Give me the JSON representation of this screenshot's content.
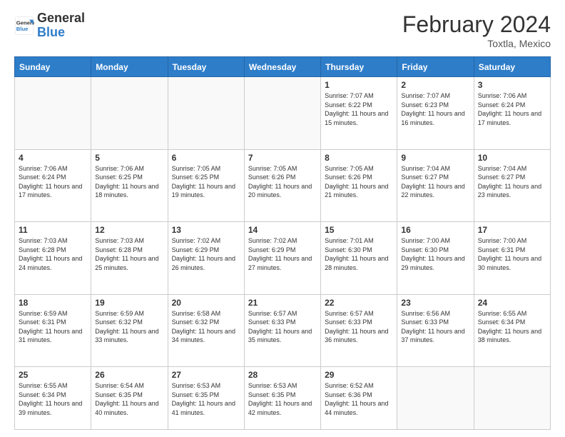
{
  "header": {
    "logo_line1": "General",
    "logo_line2": "Blue",
    "month": "February 2024",
    "location": "Toxtla, Mexico"
  },
  "weekdays": [
    "Sunday",
    "Monday",
    "Tuesday",
    "Wednesday",
    "Thursday",
    "Friday",
    "Saturday"
  ],
  "weeks": [
    [
      {
        "day": "",
        "info": ""
      },
      {
        "day": "",
        "info": ""
      },
      {
        "day": "",
        "info": ""
      },
      {
        "day": "",
        "info": ""
      },
      {
        "day": "1",
        "info": "Sunrise: 7:07 AM\nSunset: 6:22 PM\nDaylight: 11 hours and 15 minutes."
      },
      {
        "day": "2",
        "info": "Sunrise: 7:07 AM\nSunset: 6:23 PM\nDaylight: 11 hours and 16 minutes."
      },
      {
        "day": "3",
        "info": "Sunrise: 7:06 AM\nSunset: 6:24 PM\nDaylight: 11 hours and 17 minutes."
      }
    ],
    [
      {
        "day": "4",
        "info": "Sunrise: 7:06 AM\nSunset: 6:24 PM\nDaylight: 11 hours and 17 minutes."
      },
      {
        "day": "5",
        "info": "Sunrise: 7:06 AM\nSunset: 6:25 PM\nDaylight: 11 hours and 18 minutes."
      },
      {
        "day": "6",
        "info": "Sunrise: 7:05 AM\nSunset: 6:25 PM\nDaylight: 11 hours and 19 minutes."
      },
      {
        "day": "7",
        "info": "Sunrise: 7:05 AM\nSunset: 6:26 PM\nDaylight: 11 hours and 20 minutes."
      },
      {
        "day": "8",
        "info": "Sunrise: 7:05 AM\nSunset: 6:26 PM\nDaylight: 11 hours and 21 minutes."
      },
      {
        "day": "9",
        "info": "Sunrise: 7:04 AM\nSunset: 6:27 PM\nDaylight: 11 hours and 22 minutes."
      },
      {
        "day": "10",
        "info": "Sunrise: 7:04 AM\nSunset: 6:27 PM\nDaylight: 11 hours and 23 minutes."
      }
    ],
    [
      {
        "day": "11",
        "info": "Sunrise: 7:03 AM\nSunset: 6:28 PM\nDaylight: 11 hours and 24 minutes."
      },
      {
        "day": "12",
        "info": "Sunrise: 7:03 AM\nSunset: 6:28 PM\nDaylight: 11 hours and 25 minutes."
      },
      {
        "day": "13",
        "info": "Sunrise: 7:02 AM\nSunset: 6:29 PM\nDaylight: 11 hours and 26 minutes."
      },
      {
        "day": "14",
        "info": "Sunrise: 7:02 AM\nSunset: 6:29 PM\nDaylight: 11 hours and 27 minutes."
      },
      {
        "day": "15",
        "info": "Sunrise: 7:01 AM\nSunset: 6:30 PM\nDaylight: 11 hours and 28 minutes."
      },
      {
        "day": "16",
        "info": "Sunrise: 7:00 AM\nSunset: 6:30 PM\nDaylight: 11 hours and 29 minutes."
      },
      {
        "day": "17",
        "info": "Sunrise: 7:00 AM\nSunset: 6:31 PM\nDaylight: 11 hours and 30 minutes."
      }
    ],
    [
      {
        "day": "18",
        "info": "Sunrise: 6:59 AM\nSunset: 6:31 PM\nDaylight: 11 hours and 31 minutes."
      },
      {
        "day": "19",
        "info": "Sunrise: 6:59 AM\nSunset: 6:32 PM\nDaylight: 11 hours and 33 minutes."
      },
      {
        "day": "20",
        "info": "Sunrise: 6:58 AM\nSunset: 6:32 PM\nDaylight: 11 hours and 34 minutes."
      },
      {
        "day": "21",
        "info": "Sunrise: 6:57 AM\nSunset: 6:33 PM\nDaylight: 11 hours and 35 minutes."
      },
      {
        "day": "22",
        "info": "Sunrise: 6:57 AM\nSunset: 6:33 PM\nDaylight: 11 hours and 36 minutes."
      },
      {
        "day": "23",
        "info": "Sunrise: 6:56 AM\nSunset: 6:33 PM\nDaylight: 11 hours and 37 minutes."
      },
      {
        "day": "24",
        "info": "Sunrise: 6:55 AM\nSunset: 6:34 PM\nDaylight: 11 hours and 38 minutes."
      }
    ],
    [
      {
        "day": "25",
        "info": "Sunrise: 6:55 AM\nSunset: 6:34 PM\nDaylight: 11 hours and 39 minutes."
      },
      {
        "day": "26",
        "info": "Sunrise: 6:54 AM\nSunset: 6:35 PM\nDaylight: 11 hours and 40 minutes."
      },
      {
        "day": "27",
        "info": "Sunrise: 6:53 AM\nSunset: 6:35 PM\nDaylight: 11 hours and 41 minutes."
      },
      {
        "day": "28",
        "info": "Sunrise: 6:53 AM\nSunset: 6:35 PM\nDaylight: 11 hours and 42 minutes."
      },
      {
        "day": "29",
        "info": "Sunrise: 6:52 AM\nSunset: 6:36 PM\nDaylight: 11 hours and 44 minutes."
      },
      {
        "day": "",
        "info": ""
      },
      {
        "day": "",
        "info": ""
      }
    ]
  ]
}
